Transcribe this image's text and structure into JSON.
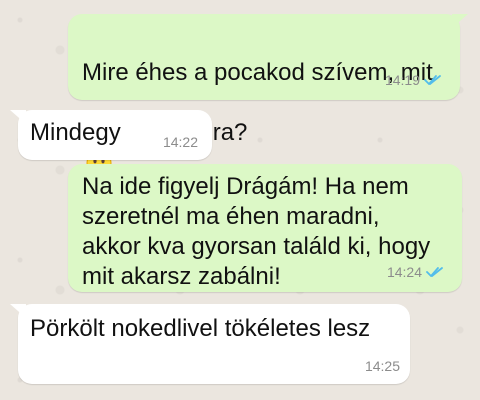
{
  "colors": {
    "outgoing_bubble": "#dcf8c6",
    "incoming_bubble": "#ffffff",
    "read_ticks": "#53bdeb",
    "time_text": "#8c8c8c"
  },
  "messages": [
    {
      "direction": "outgoing",
      "text_line1": "Mire éhes a pocakod szívem, mit",
      "text_line2": "főzzek vacsira?",
      "emoji": "smiling-face",
      "time": "14:19",
      "status": "read"
    },
    {
      "direction": "incoming",
      "text": "Mindegy",
      "time": "14:22"
    },
    {
      "direction": "outgoing",
      "text": "Na ide figyelj Drágám! Ha nem\nszeretnél ma éhen maradni,\nakkor kva gyorsan találd ki, hogy\nmit akarsz zabálni!",
      "time": "14:24",
      "status": "read"
    },
    {
      "direction": "incoming",
      "text": "Pörkölt nokedlivel tökéletes lesz",
      "time": "14:25"
    }
  ]
}
